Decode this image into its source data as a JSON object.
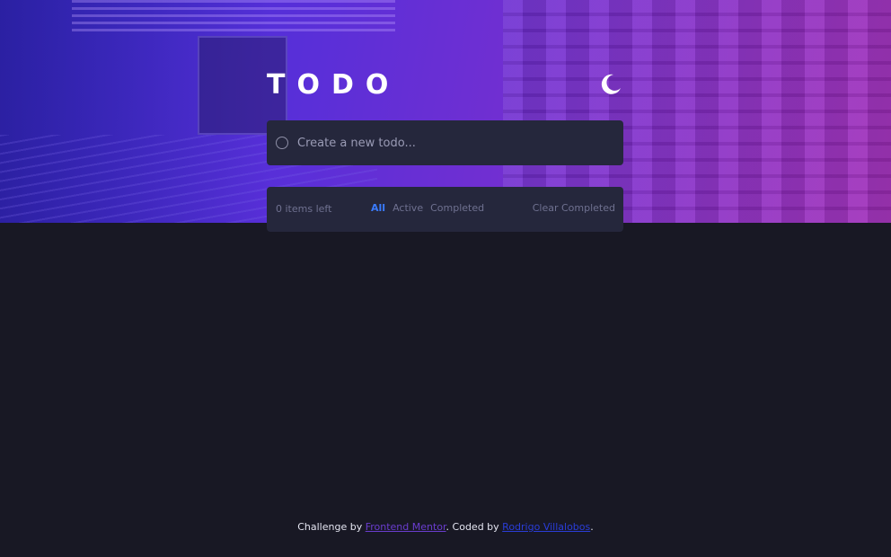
{
  "header": {
    "title": "TODO",
    "theme_toggle_icon": "moon-icon"
  },
  "new_todo": {
    "placeholder": "Create a new todo..."
  },
  "list_footer": {
    "items_left": "0 items left",
    "filters": [
      {
        "label": "All",
        "active": true
      },
      {
        "label": "Active",
        "active": false
      },
      {
        "label": "Completed",
        "active": false
      }
    ],
    "clear_label": "Clear Completed"
  },
  "attribution": {
    "prefix": "Challenge by",
    "challenge_link": "Frontend Mentor",
    "middle": ". Coded by",
    "author_link": "Rodrigo Villalobos",
    "suffix": "."
  },
  "colors": {
    "page_background": "#181824",
    "card_background": "#25273c",
    "active_filter": "#3a7bfd",
    "muted_text": "#6f7190",
    "hero_gradient_start": "#3a2fd6",
    "hero_gradient_end": "#a02cb8"
  }
}
